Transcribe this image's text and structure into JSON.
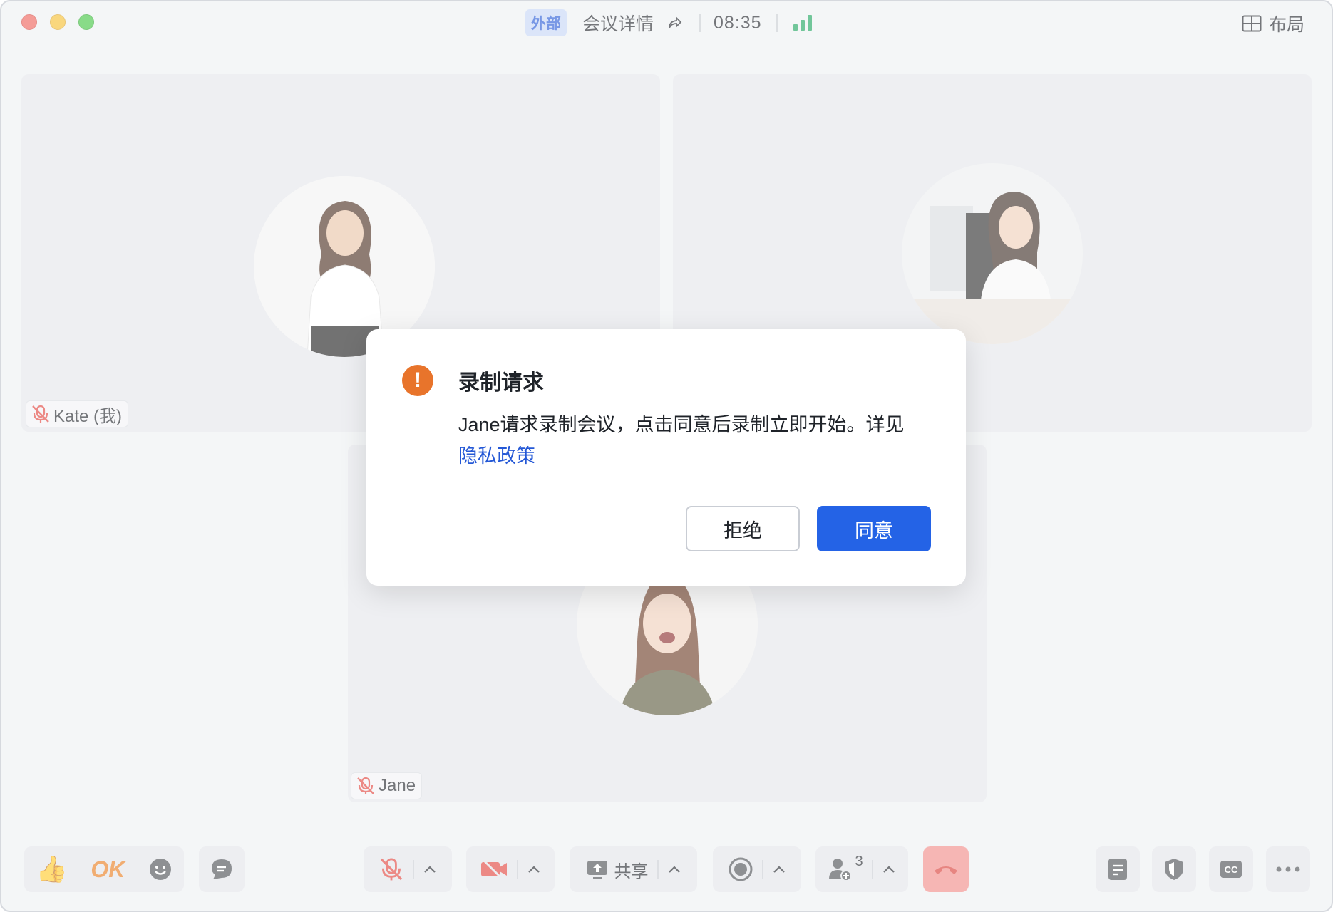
{
  "titlebar": {
    "badge": "外部",
    "meeting_details": "会议详情",
    "time": "08:35",
    "layout_label": "布局"
  },
  "tiles": {
    "kate_name": "Kate (我)",
    "jane_name": "Jane"
  },
  "toolbar": {
    "ok_label": "OK",
    "share_label": "共享",
    "participant_count": "3"
  },
  "dialog": {
    "title": "录制请求",
    "body": "Jane请求录制会议，点击同意后录制立即开始。详见",
    "link": "隐私政策",
    "decline_label": "拒绝",
    "agree_label": "同意"
  },
  "colors": {
    "accent": "#2463e6",
    "warning": "#e8742b",
    "mic_muted": "#e0413b",
    "signal": "#1aa35c"
  }
}
